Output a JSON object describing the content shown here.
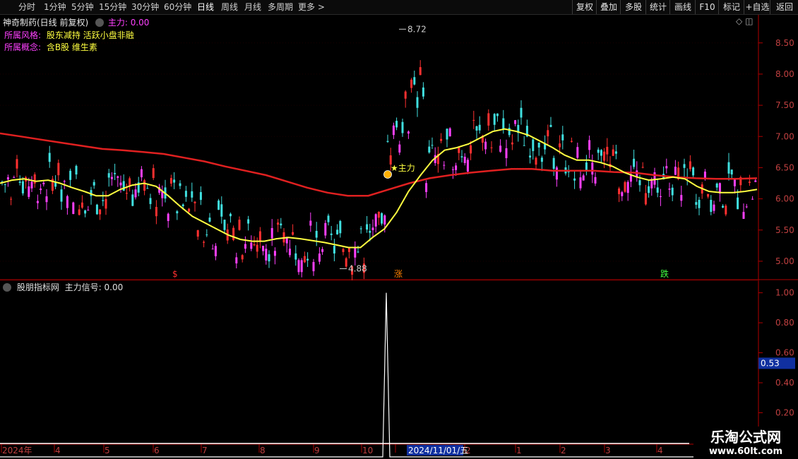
{
  "toolbar": {
    "periods": [
      "分时",
      "1分钟",
      "5分钟",
      "15分钟",
      "30分钟",
      "60分钟",
      "日线",
      "周线",
      "月线",
      "多周期",
      "更多 >"
    ],
    "active_period": "日线",
    "right_buttons": [
      "复权",
      "叠加",
      "多股",
      "统计",
      "画线",
      "F10",
      "标记",
      "+自选",
      "返回"
    ]
  },
  "main_panel": {
    "stock_title": "神奇制药(日线 前复权)",
    "indicator_name": "主力",
    "indicator_value": "0.00",
    "style_label": "所属风格:",
    "style_value": "股东减持 活跃小盘非融",
    "concept_label": "所属概念:",
    "concept_value": "含B股 维生素",
    "high_label": "8.72",
    "low_label": "4.88",
    "signal_label": "主力",
    "markers": [
      "$",
      "涨",
      "跌"
    ],
    "price_axis": [
      "8.50",
      "8.00",
      "7.50",
      "7.00",
      "6.50",
      "6.00",
      "5.50",
      "5.00"
    ]
  },
  "sub_panel": {
    "title": "股朋指标网",
    "signal_name": "主力信号:",
    "signal_value": "0.00",
    "axis": [
      "1.00",
      "0.80",
      "0.60",
      "0.40",
      "0.20"
    ],
    "cursor_value": "0.53"
  },
  "time_axis": {
    "labels": [
      "2024年",
      "4",
      "5",
      "6",
      "7",
      "8",
      "9",
      "10",
      "11",
      "2",
      "1",
      "2",
      "3",
      "4"
    ],
    "highlight": "2024/11/01/五"
  },
  "watermark": {
    "line1": "乐淘公式网",
    "line2": "www.60lt.com"
  },
  "colors": {
    "up": "#ff3030",
    "down": "#40e0e0",
    "highlight_up": "#ff40ff",
    "ma_long": "#e02020",
    "ma_short": "#ffff40",
    "axis": "#b00000"
  },
  "chart_data": [
    {
      "type": "candlestick",
      "title": "神奇制药(日线 前复权)",
      "ylim": [
        4.75,
        8.95
      ],
      "annotated_high": 8.72,
      "annotated_low": 4.88,
      "series": [
        {
          "name": "",
          "values": [
            6.25,
            6.3,
            6.32,
            6.28,
            6.3,
            6.25,
            6.18,
            6.12,
            6.05,
            6.05,
            6.15,
            6.22,
            6.25,
            6.2,
            6.05,
            5.88,
            5.72,
            5.62,
            5.52,
            5.42,
            5.35,
            5.32,
            5.32,
            5.36,
            5.38,
            5.36,
            5.33,
            5.3,
            5.26,
            5.22,
            5.22,
            5.38,
            5.52,
            5.78,
            6.12,
            6.38,
            6.62,
            6.78,
            6.82,
            6.88,
            6.98,
            7.08,
            7.12,
            7.08,
            7.02,
            6.92,
            6.82,
            6.7,
            6.62,
            6.62,
            6.58,
            6.52,
            6.42,
            6.35,
            6.3,
            6.32,
            6.35,
            6.32,
            6.2,
            6.12,
            6.1,
            6.1,
            6.12,
            6.15
          ]
        },
        {
          "name": "",
          "values": [
            7.05,
            7.0,
            6.95,
            6.9,
            6.85,
            6.8,
            6.78,
            6.75,
            6.72,
            6.66,
            6.6,
            6.52,
            6.45,
            6.38,
            6.28,
            6.18,
            6.1,
            6.05,
            6.05,
            6.15,
            6.25,
            6.33,
            6.38,
            6.42,
            6.45,
            6.48,
            6.48,
            6.45,
            6.45,
            6.45,
            6.43,
            6.42,
            6.38,
            6.35,
            6.33,
            6.32,
            6.32,
            6.33
          ]
        }
      ]
    },
    {
      "type": "line",
      "title": "股朋指标网",
      "ylim": [
        0,
        1.05
      ],
      "series": [
        {
          "name": "主力信号",
          "spike_value": 1.0
        }
      ]
    }
  ]
}
